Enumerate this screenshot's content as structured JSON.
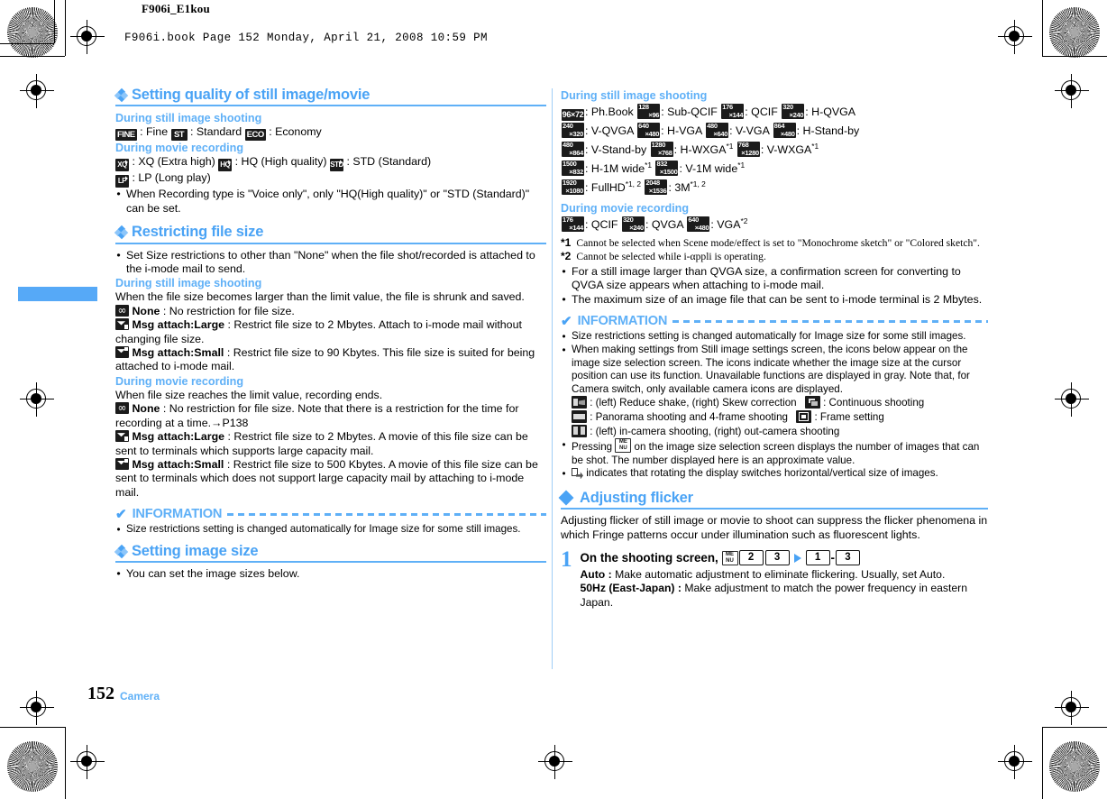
{
  "header": {
    "book_name": "F906i_E1kou",
    "print_line": "F906i.book  Page 152  Monday, April 21, 2008  10:59 PM"
  },
  "footer": {
    "page_number": "152",
    "chapter": "Camera"
  },
  "colors": {
    "accent": "#4aa3f5",
    "rule": "#5fb0f7",
    "tab": "#56a9f7"
  },
  "left_column": {
    "section1": {
      "title": "Setting quality of still image/movie",
      "sub1": "During still image shooting",
      "quality_still": [
        {
          "icon": "FINE",
          "label": ": Fine"
        },
        {
          "icon": "ST",
          "label": ": Standard"
        },
        {
          "icon": "ECO",
          "label": ": Economy"
        }
      ],
      "sub2": "During movie recording",
      "quality_movie": [
        {
          "icon": "XQ",
          "label": ": XQ (Extra high)"
        },
        {
          "icon": "HQ",
          "label": ": HQ (High quality)"
        },
        {
          "icon": "STD",
          "label": ": STD (Standard)"
        },
        {
          "icon": "LP",
          "label": ": LP (Long play)"
        }
      ],
      "note": "When Recording type is \"Voice only\", only \"HQ(High quality)\" or \"STD (Standard)\" can be set."
    },
    "section2": {
      "title": "Restricting file size",
      "note": "Set Size restrictions to other than \"None\" when the file shot/recorded is attached to the i-mode mail to send.",
      "sub1": "During still image shooting",
      "still_intro": "When the file size becomes larger than the limit value, the file is shrunk and saved.",
      "still_items": [
        {
          "icon": "none",
          "name": "None",
          "text": ": No restriction for file size."
        },
        {
          "icon": "mail-large",
          "name": "Msg attach:Large",
          "text": ": Restrict file size to 2 Mbytes. Attach to i-mode mail without changing file size."
        },
        {
          "icon": "mail-small",
          "name": "Msg attach:Small",
          "text": ": Restrict file size to 90 Kbytes. This file size is suited for being attached to i-mode mail."
        }
      ],
      "sub2": "During movie recording",
      "movie_intro": "When file size reaches the limit value, recording ends.",
      "movie_items": [
        {
          "icon": "none",
          "name": "None",
          "text": ": No restriction for file size. Note that there is a restriction for the time for recording at a time.→P138"
        },
        {
          "icon": "mail-large",
          "name": "Msg attach:Large",
          "text": ": Restrict file size to 2 Mbytes. A movie of this file size can be sent to terminals which supports large capacity mail."
        },
        {
          "icon": "mail-small",
          "name": "Msg attach:Small",
          "text": ": Restrict file size to 500 Kbytes. A movie of this file size can be sent to terminals which does not support large capacity mail by attaching to i-mode mail."
        }
      ],
      "info_head": "INFORMATION",
      "info_items": [
        "Size restrictions setting is changed automatically for Image size for some still images."
      ]
    },
    "section3": {
      "title": "Setting image size",
      "note": "You can set the image sizes below."
    }
  },
  "right_column": {
    "still_sub": "During still image shooting",
    "still_sizes": [
      {
        "w": "96",
        "h": "×72",
        "single": true,
        "label": ": Ph.Book",
        "sup": ""
      },
      {
        "w": "128",
        "h": "×96",
        "label": ": Sub-QCIF",
        "sup": ""
      },
      {
        "w": "176",
        "h": "×144",
        "label": ": QCIF",
        "sup": ""
      },
      {
        "w": "320",
        "h": "×240",
        "label": ": H-QVGA",
        "sup": ""
      },
      {
        "w": "240",
        "h": "×320",
        "label": ": V-QVGA",
        "sup": ""
      },
      {
        "w": "640",
        "h": "×480",
        "label": ": H-VGA",
        "sup": ""
      },
      {
        "w": "480",
        "h": "×640",
        "label": ": V-VGA",
        "sup": ""
      },
      {
        "w": "864",
        "h": "×480",
        "label": ": H-Stand-by",
        "sup": ""
      },
      {
        "w": "480",
        "h": "×864",
        "label": ": V-Stand-by",
        "sup": ""
      },
      {
        "w": "1280",
        "h": "×768",
        "label": ": H-WXGA",
        "sup": "*1"
      },
      {
        "w": "768",
        "h": "×1280",
        "label": ": V-WXGA",
        "sup": "*1"
      },
      {
        "w": "1500",
        "h": "×832",
        "label": ": H-1M wide",
        "sup": "*1"
      },
      {
        "w": "832",
        "h": "×1500",
        "label": ": V-1M wide",
        "sup": "*1"
      },
      {
        "w": "1920",
        "h": "×1080",
        "label": ": FullHD",
        "sup": "*1, 2"
      },
      {
        "w": "2048",
        "h": "×1536",
        "label": ": 3M",
        "sup": "*1, 2"
      }
    ],
    "movie_sub": "During movie recording",
    "movie_sizes": [
      {
        "w": "176",
        "h": "×144",
        "label": ": QCIF",
        "sup": ""
      },
      {
        "w": "320",
        "h": "×240",
        "label": ": QVGA",
        "sup": ""
      },
      {
        "w": "640",
        "h": "×480",
        "label": ": VGA",
        "sup": "*2"
      }
    ],
    "footnotes": [
      {
        "mark": "*1",
        "text": "Cannot be selected when Scene mode/effect is set to \"Monochrome sketch\" or \"Colored sketch\"."
      },
      {
        "mark": "*2",
        "text": "Cannot be selected while i-αppli is operating."
      }
    ],
    "bullets": [
      "For a still image larger than QVGA size, a confirmation screen for converting to QVGA size appears when attaching to i-mode mail.",
      "The maximum size of an image file that can be sent to i-mode terminal is 2 Mbytes."
    ],
    "info_head": "INFORMATION",
    "info_items": [
      "Size restrictions setting is changed automatically for Image size for some still images.",
      "When making settings from Still image settings screen, the icons below appear on the image size selection screen. The icons indicate whether the image size at the cursor position can use its function. Unavailable functions are displayed in gray. Note that, for Camera switch, only available camera icons are displayed."
    ],
    "icon_legend": [
      {
        "icon": "shake",
        "text": ": (left) Reduce shake, (right) Skew correction"
      },
      {
        "icon": "cont",
        "text": ": Continuous shooting"
      },
      {
        "icon": "pano",
        "text": ": Panorama shooting and 4-frame shooting"
      },
      {
        "icon": "frame",
        "text": ": Frame setting"
      },
      {
        "icon": "cam",
        "text": ": (left) in-camera shooting, (right) out-camera shooting"
      }
    ],
    "info_items_tail": [
      {
        "pre": "Pressing ",
        "mid": "menu-icon",
        "post": " on the image size selection screen displays the number of images that can be shot. The number displayed here is an approximate value."
      },
      {
        "pre": "",
        "mid": "rotate-icon",
        "post": " indicates that rotating the display switches horizontal/vertical size of images."
      }
    ],
    "section_flicker": {
      "title": "Adjusting flicker",
      "intro": "Adjusting flicker of still image or movie to shoot can suppress the flicker phenomena in which Fringe patterns occur under illumination such as fluorescent lights.",
      "step_number": "1",
      "step_title": "On the shooting screen,",
      "keys": [
        "MENU",
        "2",
        "3"
      ],
      "keys_after": [
        "1",
        "3"
      ],
      "key_separator": "-",
      "options": [
        {
          "name": "Auto :",
          "text": " Make automatic adjustment to eliminate flickering. Usually, set Auto."
        },
        {
          "name": "50Hz (East-Japan) :",
          "text": " Make adjustment to match the power frequency in eastern Japan."
        }
      ]
    }
  }
}
